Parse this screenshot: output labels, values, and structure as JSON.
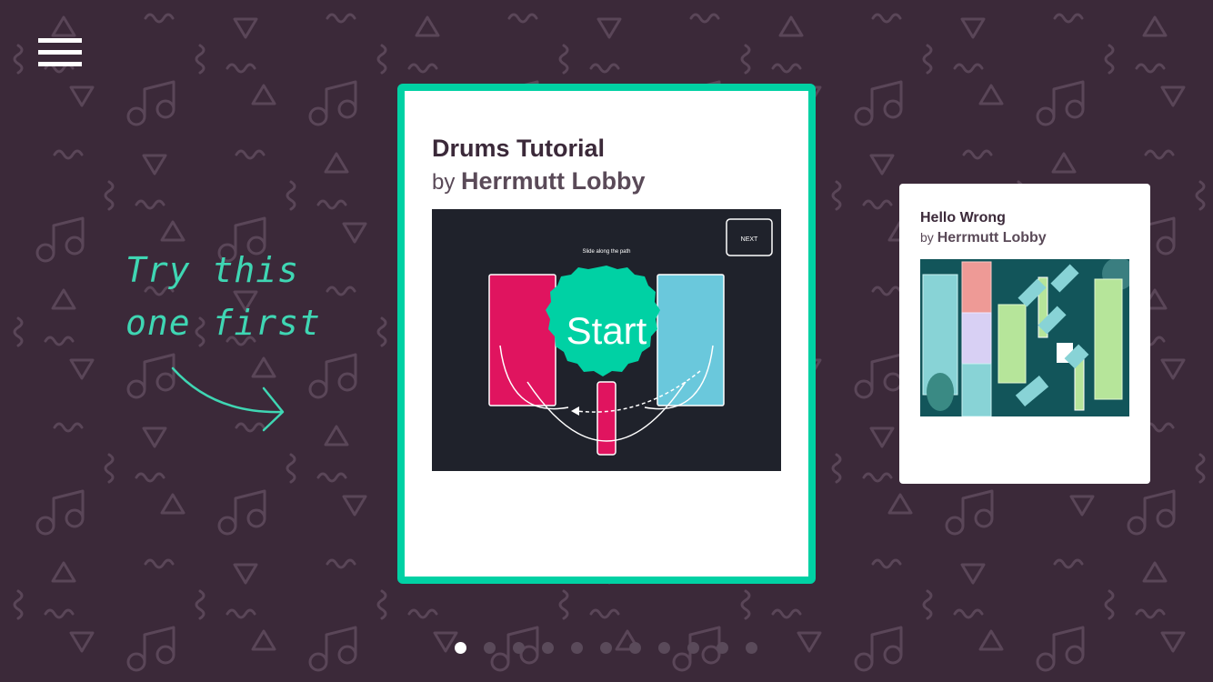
{
  "menu": {
    "icon": "hamburger-icon"
  },
  "hint": {
    "line1": "Try this",
    "line2": "one first",
    "arrow_icon": "curved-arrow-right-icon"
  },
  "featured": {
    "title": "Drums Tutorial",
    "by_label": "by",
    "author": "Herrmutt Lobby",
    "thumbnail": {
      "next_label": "NEXT",
      "instruction": "Slide along the path",
      "start_label": "Start"
    }
  },
  "next_card": {
    "title": "Hello Wrong",
    "by_label": "by",
    "author": "Herrmutt Lobby"
  },
  "pagination": {
    "count": 11,
    "active_index": 0
  },
  "colors": {
    "background": "#3b2939",
    "accent": "#00d1a4",
    "hint": "#3fd6b3",
    "pad_pink": "#e0145f",
    "pad_blue": "#6ac8dc",
    "thumb_dark": "#1f222b",
    "thumb_teal": "#12555a"
  }
}
